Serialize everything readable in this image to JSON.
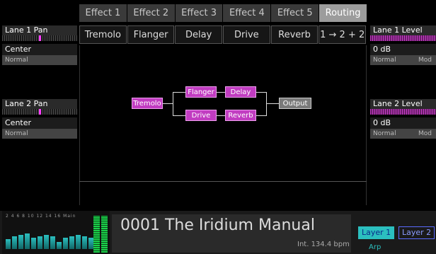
{
  "tabs": [
    {
      "label": "Effect 1",
      "active": false
    },
    {
      "label": "Effect 2",
      "active": false
    },
    {
      "label": "Effect 3",
      "active": false
    },
    {
      "label": "Effect 4",
      "active": false
    },
    {
      "label": "Effect 5",
      "active": false
    },
    {
      "label": "Routing",
      "active": true
    }
  ],
  "effects": [
    "Tremolo",
    "Flanger",
    "Delay",
    "Drive",
    "Reverb",
    "1 → 2 + 2"
  ],
  "left_panel": {
    "lanes": [
      {
        "title": "Lane 1 Pan",
        "value": "Center",
        "mode": "Normal",
        "pan": 0.5
      },
      {
        "title": "Lane 2 Pan",
        "value": "Center",
        "mode": "Normal",
        "pan": 0.5
      }
    ]
  },
  "right_panel": {
    "lanes": [
      {
        "title": "Lane 1 Level",
        "value": "0 dB",
        "mode": "Normal",
        "mod": "Mod",
        "level": 1.0
      },
      {
        "title": "Lane 2 Level",
        "value": "0 dB",
        "mode": "Normal",
        "mod": "Mod",
        "level": 1.0
      }
    ]
  },
  "routing": {
    "nodes": {
      "tremolo": "Tremolo",
      "flanger": "Flanger",
      "delay": "Delay",
      "drive": "Drive",
      "reverb": "Reverb",
      "output": "Output"
    }
  },
  "mixer": {
    "labels": "2 4 6 8 10 12 14 16 Main",
    "levels": [
      0.35,
      0.45,
      0.5,
      0.55,
      0.4,
      0.45,
      0.5,
      0.45,
      0.25,
      0.4,
      0.45,
      0.5,
      0.45,
      0.4,
      0.35,
      0.45
    ],
    "main_levels": [
      1.0,
      1.0
    ]
  },
  "patch": {
    "name": "0001 The Iridium Manual",
    "tempo": "Int. 134.4 bpm"
  },
  "layers": {
    "layer1": "Layer 1",
    "layer2": "Layer 2",
    "arp": "Arp"
  },
  "colors": {
    "accent_magenta": "#c13cc1",
    "accent_cyan": "#2bbfbf",
    "active_tab": "#9c9c9c"
  }
}
